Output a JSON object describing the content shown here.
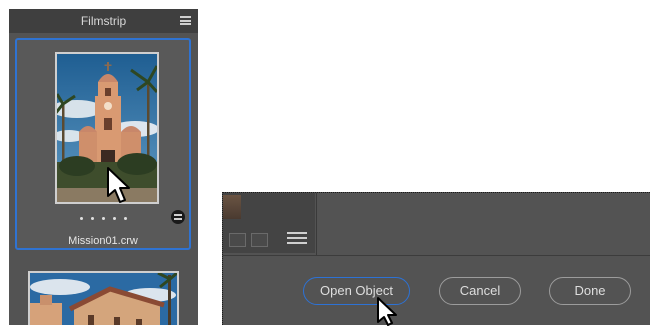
{
  "filmstrip": {
    "title": "Filmstrip",
    "menu_icon": "hamburger-menu-icon",
    "items": [
      {
        "filename": "Mission01.crw",
        "selected": true,
        "rating_dots": 5
      },
      {
        "filename": ""
      }
    ]
  },
  "buttons": {
    "open_object": "Open Object",
    "cancel": "Cancel",
    "done": "Done"
  },
  "colors": {
    "panel": "#535353",
    "header": "#3f3f3f",
    "selection_accent": "#2f73d2"
  }
}
